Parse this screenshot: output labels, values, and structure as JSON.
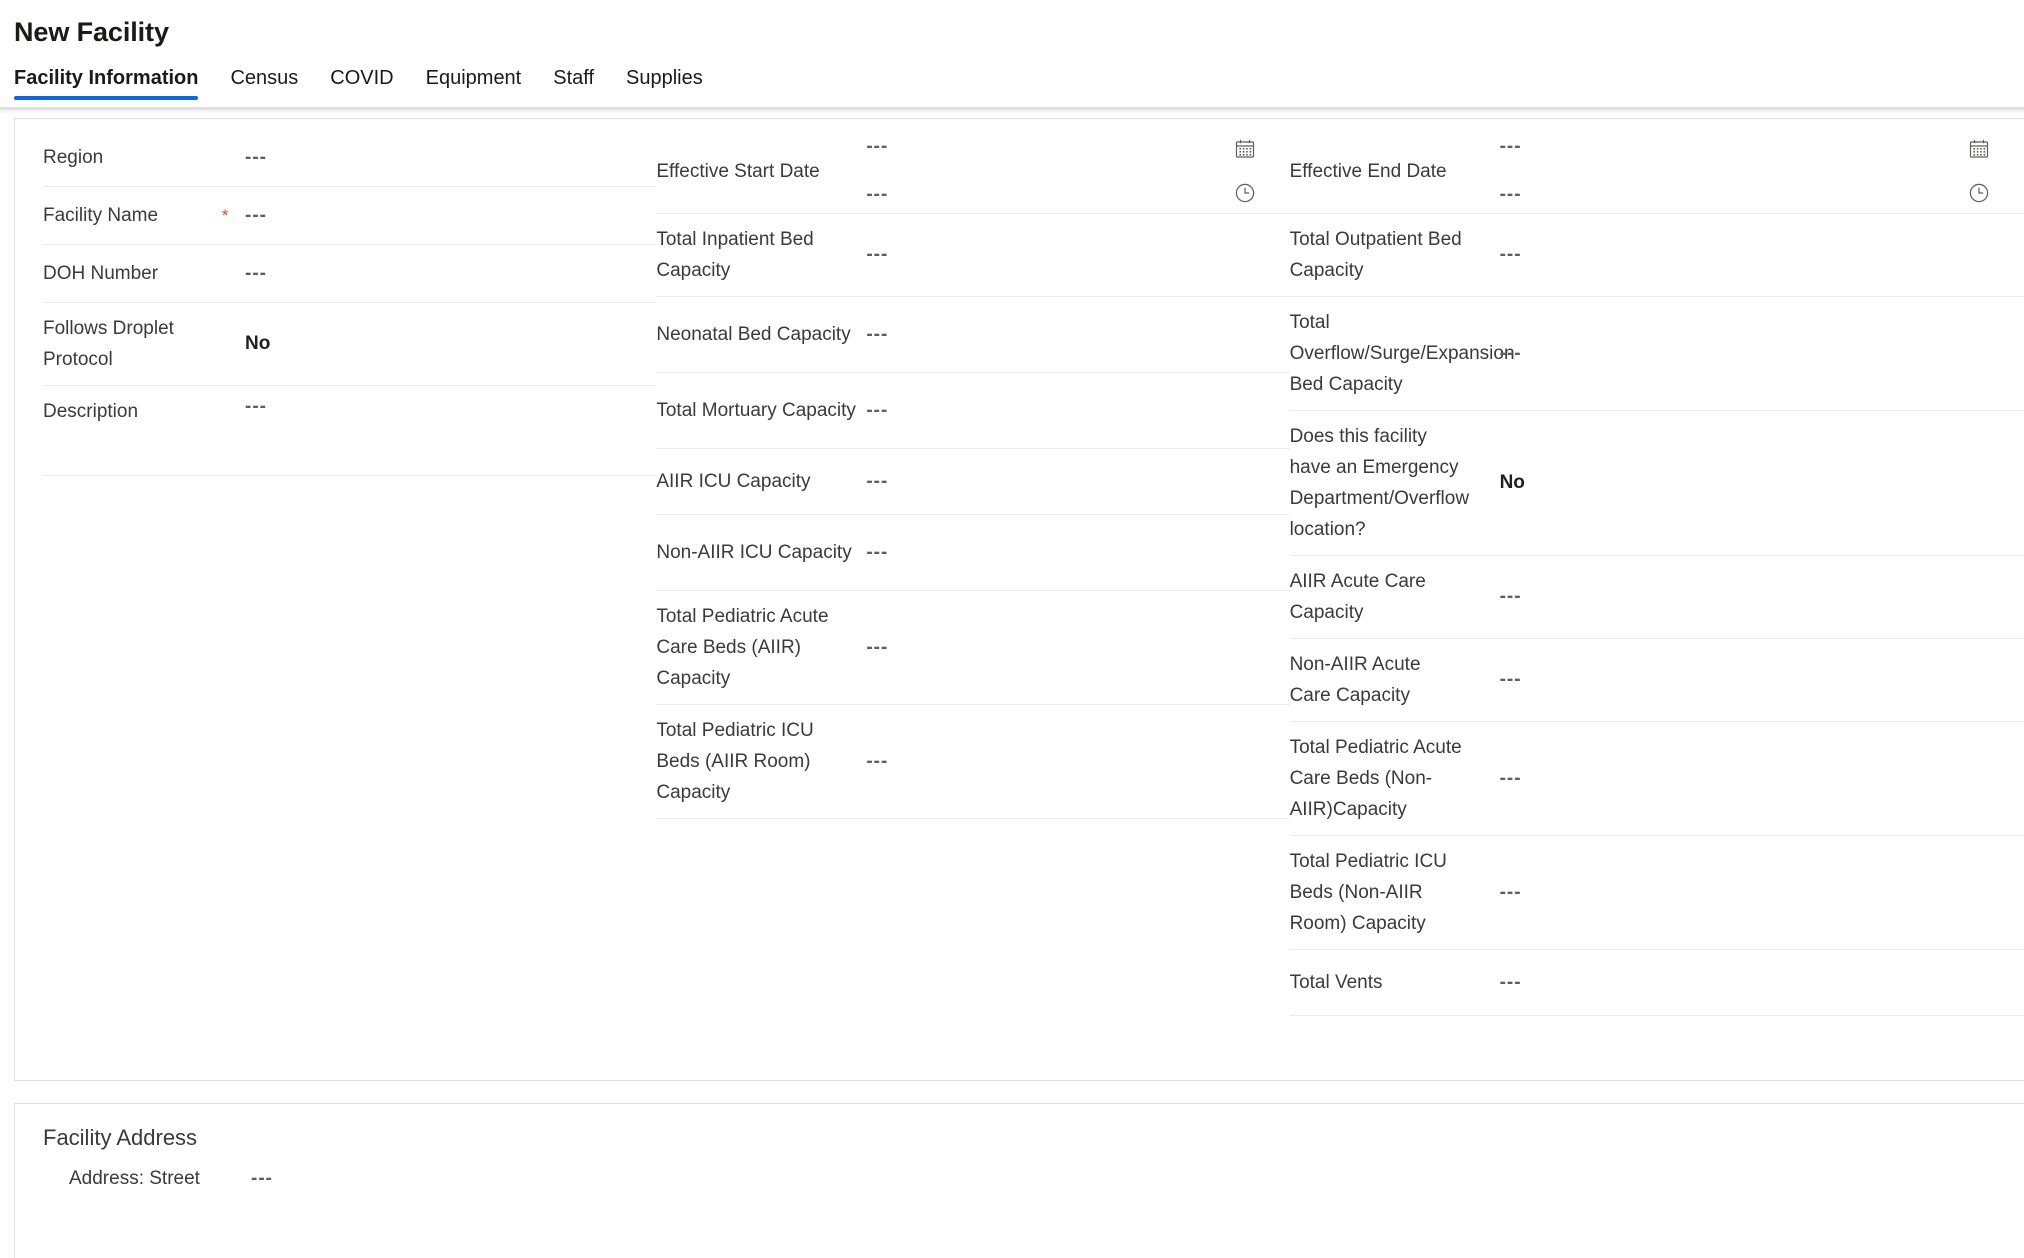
{
  "theme": {
    "accent": "#1267d4",
    "required_star_color": "#e8453c",
    "rule_color": "#edebe9"
  },
  "header": {
    "title": "New Facility",
    "tabs": [
      {
        "label": "Facility Information",
        "selected": true
      },
      {
        "label": "Census",
        "selected": false
      },
      {
        "label": "COVID",
        "selected": false
      },
      {
        "label": "Equipment",
        "selected": false
      },
      {
        "label": "Staff",
        "selected": false
      },
      {
        "label": "Supplies",
        "selected": false
      }
    ]
  },
  "placeholder": "---",
  "form": {
    "column1": [
      {
        "label": "Region",
        "value": "---",
        "required": false
      },
      {
        "label": "Facility Name",
        "value": "---",
        "required": true
      },
      {
        "label": "DOH Number",
        "value": "---",
        "required": false
      },
      {
        "label": "Follows Droplet Protocol",
        "value": "No",
        "required": false,
        "bold": true
      },
      {
        "label": "Description",
        "value": "---",
        "required": false
      }
    ],
    "column2": {
      "datetime_field": {
        "label": "Effective Start Date",
        "date_value": "---",
        "time_value": "---",
        "date_icon": "calendar-icon",
        "time_icon": "clock-icon"
      },
      "fields": [
        {
          "label": "Total Inpatient Bed Capacity",
          "value": "---"
        },
        {
          "label": "Neonatal Bed Capacity",
          "value": "---"
        },
        {
          "label": "Total Mortuary Capacity",
          "value": "---"
        },
        {
          "label": "AIIR ICU Capacity",
          "value": "---"
        },
        {
          "label": "Non-AIIR ICU Capacity",
          "value": "---"
        },
        {
          "label": "Total Pediatric Acute Care Beds (AIIR) Capacity",
          "value": "---"
        },
        {
          "label": "Total Pediatric ICU Beds (AIIR Room) Capacity",
          "value": "---"
        }
      ]
    },
    "column3": {
      "datetime_field": {
        "label": "Effective End Date",
        "date_value": "---",
        "time_value": "---",
        "date_icon": "calendar-icon",
        "time_icon": "clock-icon"
      },
      "fields": [
        {
          "label": "Total Outpatient Bed Capacity",
          "value": "---",
          "bold": false
        },
        {
          "label": "Total Overflow/Surge/Expansion Bed Capacity",
          "value": "---",
          "bold": false
        },
        {
          "label": "Does this facility have an Emergency Department/Overflow location?",
          "value": "No",
          "bold": true
        },
        {
          "label": "AIIR Acute Care Capacity",
          "value": "---",
          "bold": false
        },
        {
          "label": "Non-AIIR Acute Care Capacity",
          "value": "---",
          "bold": false
        },
        {
          "label": "Total Pediatric Acute Care Beds (Non-AIIR)Capacity",
          "value": "---",
          "bold": false
        },
        {
          "label": "Total Pediatric ICU Beds (Non-AIIR Room) Capacity",
          "value": "---",
          "bold": false
        },
        {
          "label": "Total Vents",
          "value": "---",
          "bold": false
        }
      ]
    }
  },
  "address_section": {
    "title": "Facility Address",
    "fields": [
      {
        "label": "Address: Street",
        "value": "---"
      }
    ]
  }
}
